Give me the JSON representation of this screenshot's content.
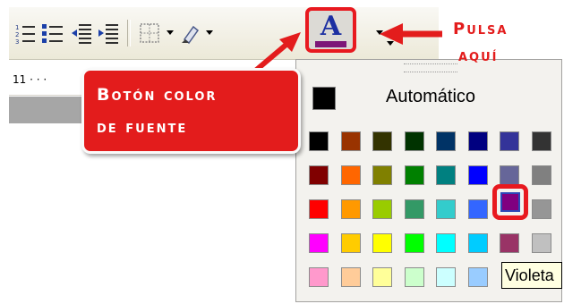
{
  "toolbar": {
    "buttons": [
      "numbered-list",
      "bulleted-list",
      "decrease-indent",
      "increase-indent",
      "borders",
      "highlight",
      "font-color"
    ]
  },
  "ruler": {
    "position": "11 · · ·"
  },
  "font_color_button": {
    "letter": "A",
    "current_color": "#7d1778"
  },
  "palette": {
    "automatic_label": "Automático",
    "automatic_color": "#000000",
    "rows": [
      [
        "#000000",
        "#993300",
        "#333300",
        "#003300",
        "#003366",
        "#000080",
        "#333399",
        "#333333"
      ],
      [
        "#800000",
        "#FF6600",
        "#808000",
        "#008000",
        "#008080",
        "#0000FF",
        "#666699",
        "#808080"
      ],
      [
        "#FF0000",
        "#FF9900",
        "#99CC00",
        "#339966",
        "#33CCCC",
        "#3366FF",
        "#800080",
        "#969696"
      ],
      [
        "#FF00FF",
        "#FFCC00",
        "#FFFF00",
        "#00FF00",
        "#00FFFF",
        "#00CCFF",
        "#993366",
        "#C0C0C0"
      ],
      [
        "#FF99CC",
        "#FFCC99",
        "#FFFF99",
        "#CCFFCC",
        "#CCFFFF",
        "#99CCFF",
        "#CC99FF",
        "#FFFFFF"
      ]
    ],
    "highlighted_color": "#800080",
    "tooltip": "Violeta"
  },
  "annotations": {
    "callout_line1": "Botón color",
    "callout_line2": "de fuente",
    "pulsa": "Pulsa",
    "aqui": "aquí",
    "accent": "#e31c1c"
  }
}
